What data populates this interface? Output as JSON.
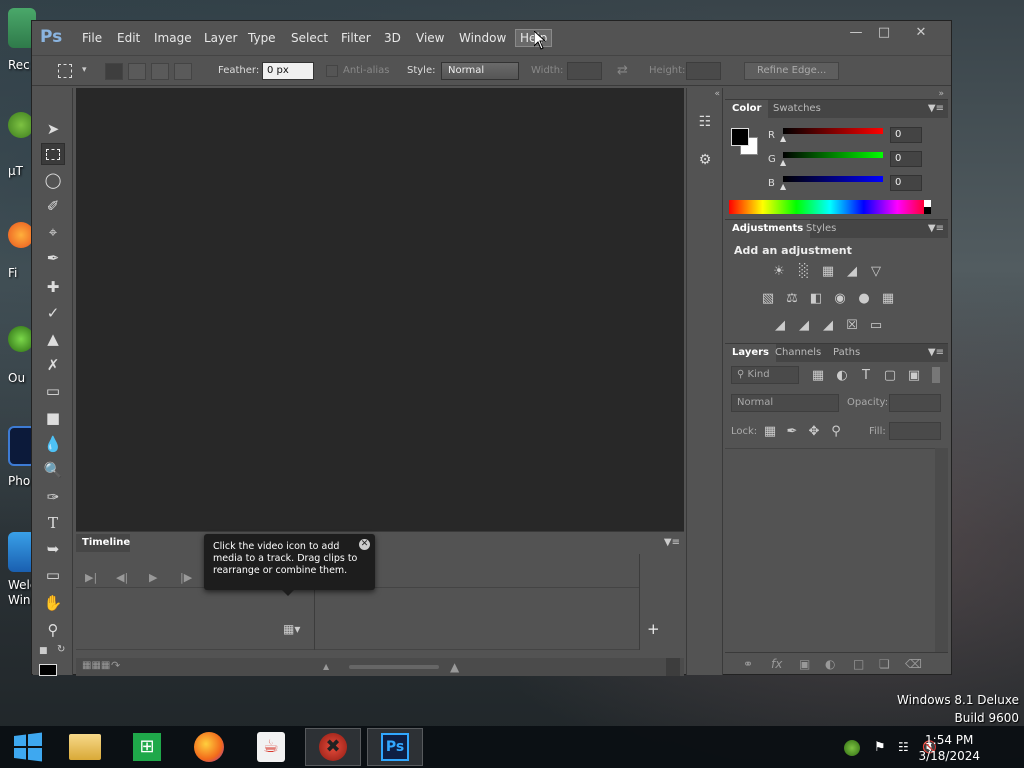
{
  "desktop": {
    "icons": [
      {
        "name": "recycle-bin",
        "label": "Rec"
      },
      {
        "name": "utorrent",
        "label": "µT"
      },
      {
        "name": "firefox",
        "label": "Fi"
      },
      {
        "name": "outlook",
        "label": "Ou"
      },
      {
        "name": "photoshop",
        "label": "Pho"
      },
      {
        "name": "welcome",
        "label": "Welc\nWind"
      }
    ]
  },
  "watermark": {
    "line1": "Windows 8.1 Deluxe",
    "line2": "Build 9600"
  },
  "taskbar": {
    "items": [
      "start-icon",
      "file-explorer-icon",
      "store-icon",
      "firefox-icon",
      "java-icon",
      "unknown-app-icon",
      "photoshop-icon"
    ],
    "clock_time": "1:54 PM",
    "clock_date": "3/18/2024"
  },
  "ps": {
    "logo": "Ps",
    "menu": [
      "File",
      "Edit",
      "Image",
      "Layer",
      "Type",
      "Select",
      "Filter",
      "3D",
      "View",
      "Window",
      "Help"
    ],
    "options": {
      "feather_label": "Feather:",
      "feather_value": "0 px",
      "antialias_label": "Anti-alias",
      "style_label": "Style:",
      "style_value": "Normal",
      "width_label": "Width:",
      "height_label": "Height:",
      "refine_edge": "Refine Edge..."
    },
    "timeline": {
      "tab": "Timeline",
      "tooltip": "Click the video icon to add media to a track. Drag clips to rearrange or combine them."
    },
    "color_panel": {
      "tabs": [
        "Color",
        "Swatches"
      ],
      "r_label": "R",
      "g_label": "G",
      "b_label": "B",
      "r_value": "0",
      "g_value": "0",
      "b_value": "0"
    },
    "adjustments_panel": {
      "tabs": [
        "Adjustments",
        "Styles"
      ],
      "heading": "Add an adjustment"
    },
    "layers_panel": {
      "tabs": [
        "Layers",
        "Channels",
        "Paths"
      ],
      "kind": "Kind",
      "blend_mode": "Normal",
      "opacity_label": "Opacity:",
      "lock_label": "Lock:",
      "fill_label": "Fill:"
    }
  }
}
